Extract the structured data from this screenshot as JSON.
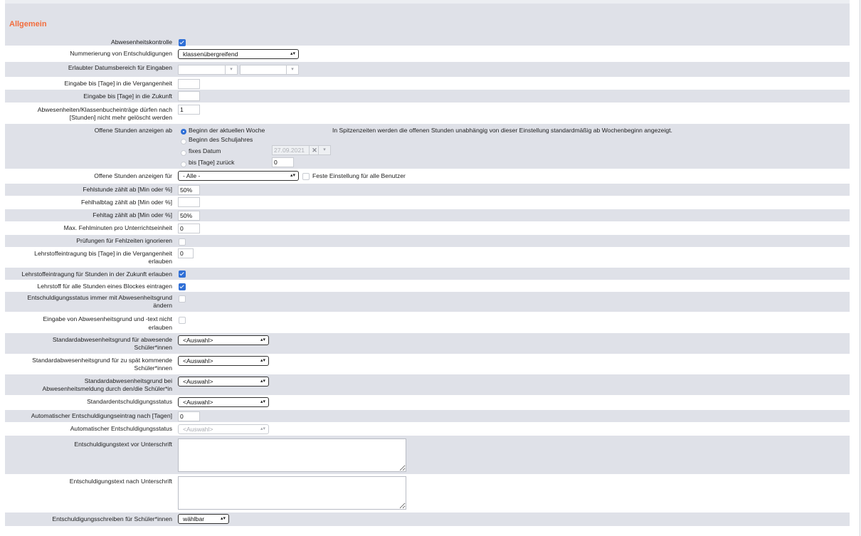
{
  "section_title": "Allgemein",
  "rows": {
    "abwesenheitskontrolle": "Abwesenheitskontrolle",
    "nummerierung": "Nummerierung von Entschuldigungen",
    "datumsbereich": "Erlaubter Datumsbereich für Eingaben",
    "vergangenheit": "Eingabe bis [Tage] in die Vergangenheit",
    "zukunft": "Eingabe bis [Tage] in die Zukunft",
    "geloescht_1": "Abwesenheiten/Klassenbucheinträge dürfen nach",
    "geloescht_2": "[Stunden] nicht mehr gelöscht werden",
    "offene_ab": "Offene Stunden anzeigen ab",
    "offene_fuer": "Offene Stunden anzeigen für",
    "fehlstunde": "Fehlstunde zählt ab [Min oder %]",
    "fehlhalbtag": "Fehlhalbtag zählt ab [Min oder %]",
    "fehltag": "Fehltag zählt ab [Min oder %]",
    "max_fehlminuten": "Max. Fehlminuten pro Unterrichtseinheit",
    "pruefungen": "Prüfungen für Fehlzeiten ignorieren",
    "lehrstoff_verg_1": "Lehrstoffeintragung bis [Tage] in die Vergangenheit",
    "lehrstoff_verg_2": "erlauben",
    "lehrstoff_zukunft": "Lehrstoffeintragung für Stunden in der Zukunft erlauben",
    "lehrstoff_block": "Lehrstoff für alle Stunden eines Blockes eintragen",
    "entsch_status_1": "Entschuldigungsstatus immer mit Abwesenheitsgrund",
    "entsch_status_2": "ändern",
    "eingabe_grund_1": "Eingabe von Abwesenheitsgrund und -text nicht",
    "eingabe_grund_2": "erlauben",
    "std_abwesend_1": "Standardabwesenheitsgrund für abwesende",
    "std_abwesend_2": "Schüler*innen",
    "std_spaet_1": "Standardabwesenheitsgrund für zu spät kommende",
    "std_spaet_2": "Schüler*innen",
    "std_meldung_1": "Standardabwesenheitsgrund bei",
    "std_meldung_2": "Abwesenheitsmeldung durch den/die Schüler*in",
    "std_entsch_status": "Standardentschuldigungsstatus",
    "auto_eintrag": "Automatischer Entschuldigungseintrag nach [Tagen]",
    "auto_status": "Automatischer Entschuldigungsstatus",
    "text_vor": "Entschuldigungstext vor Unterschrift",
    "text_nach": "Entschuldigungstext nach Unterschrift",
    "schreiben": "Entschuldigungsschreiben für Schüler*innen"
  },
  "values": {
    "nummerierung_select": "klassenübergreifend",
    "geloescht_value": "1",
    "fehlstunde_value": "50%",
    "fehltag_value": "50%",
    "max_fehlminuten_value": "0",
    "lehrstoff_verg_value": "0",
    "auto_eintrag_value": "0",
    "offene_fuer_select": "- Alle -",
    "feste_einstellung": "Feste Einstellung für alle Benutzer",
    "auswahl": "<Auswahl>",
    "schreiben_select": "wählbar",
    "fixes_datum": "27.09.2021",
    "bis_tage_value": "0"
  },
  "radio_options": {
    "woche": "Beginn der aktuellen Woche",
    "schuljahr": "Beginn des Schuljahres",
    "fixes": "fixes Datum",
    "bis_tage": "bis [Tage] zurück"
  },
  "hint": "In Spitzenzeiten werden die offenen Stunden unabhängig von dieser Einstellung standardmäßig ab Wochenbeginn angezeigt.",
  "checkbox_states": {
    "abwesenheitskontrolle": true,
    "feste_einstellung": false,
    "pruefungen": false,
    "lehrstoff_zukunft": true,
    "lehrstoff_block": true,
    "entsch_status": false,
    "eingabe_grund": false
  },
  "colors": {
    "accent": "#f26d3d",
    "band": "#dfe1e8",
    "checked": "#2f6fd6"
  }
}
